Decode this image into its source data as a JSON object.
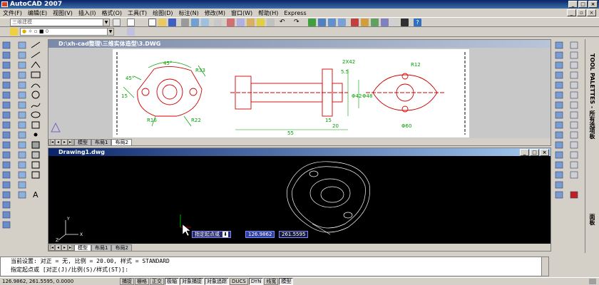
{
  "app": {
    "title": "AutoCAD 2007"
  },
  "menu": [
    "文件(F)",
    "编辑(E)",
    "视图(V)",
    "插入(I)",
    "格式(O)",
    "工具(T)",
    "绘图(D)",
    "标注(N)",
    "修改(M)",
    "窗口(W)",
    "帮助(H)",
    "Express"
  ],
  "toolbar": {
    "workspace_combo": "三维建模",
    "layer_combo": "0"
  },
  "doc1": {
    "title": "D:\\xh-cad整理\\三维实体造型\\3.DWG",
    "tabs": [
      "模型",
      "布局1",
      "布局2"
    ],
    "active_tab": "布局2",
    "dims": [
      "45°",
      "45°",
      "R33",
      "R16",
      "R22",
      "15",
      "R12",
      "Φ60",
      "2X42",
      "Φ42",
      "Φ48",
      "5.5",
      "20",
      "15",
      "55"
    ]
  },
  "doc2": {
    "title": "Drawing1.dwg",
    "tabs": [
      "模型",
      "布局1",
      "布局2"
    ],
    "active_tab": "模型",
    "prompt_label": "指定起点或",
    "prompt_x": "126.9862",
    "prompt_y": "261.5595",
    "axis_x": "X",
    "axis_y": "Y",
    "axis_z": "Z"
  },
  "command": {
    "line1": "当前设置: 对正 = 无, 比例 = 20.00, 样式 = STANDARD",
    "line2": "指定起点或 [对正(J)/比例(S)/样式(ST)]:"
  },
  "status": {
    "coords": "126.9862, 261.5595, 0.0000",
    "buttons": [
      "捕捉",
      "栅格",
      "正交",
      "极轴",
      "对象捕捉",
      "对象追踪",
      "DUCS",
      "DYN",
      "线宽",
      "模型"
    ],
    "active_buttons": [
      "极轴",
      "对象捕捉",
      "对象追踪",
      "DYN",
      "模型"
    ]
  },
  "palette": {
    "title": "TOOL PALETTES - 所有选项板",
    "face_label": "面板"
  },
  "colors": {
    "accent": "#0a246a",
    "model_bg": "#000000"
  }
}
